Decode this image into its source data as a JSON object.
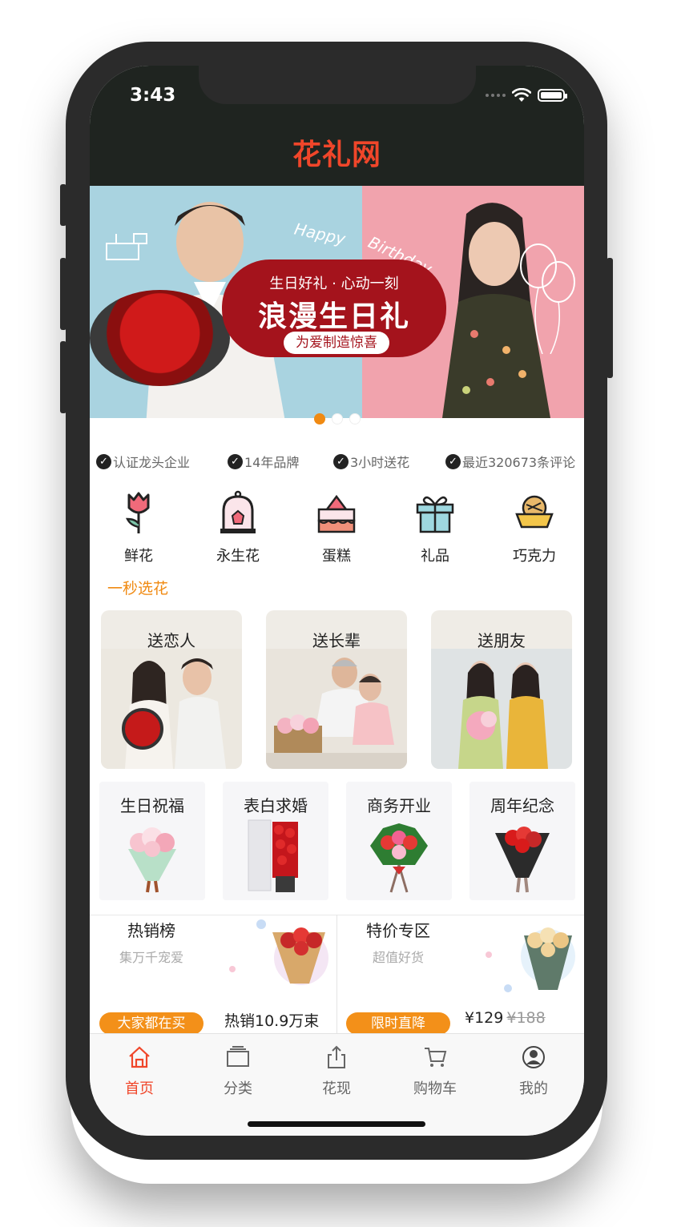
{
  "status": {
    "time": "3:43"
  },
  "app": {
    "title": "花礼网"
  },
  "banner": {
    "subtitle": "生日好礼 · 心动一刻",
    "title": "浪漫生日礼",
    "pill": "为爱制造惊喜",
    "script_left": "Happy",
    "script_right": "Birthday",
    "active_dot": 1,
    "dot_count": 3
  },
  "trust": [
    "认证龙头企业",
    "14年品牌",
    "3小时送花",
    "最近320673条评论"
  ],
  "categories": [
    {
      "label": "鲜花",
      "icon": "tulip-icon"
    },
    {
      "label": "永生花",
      "icon": "glass-dome-flower-icon"
    },
    {
      "label": "蛋糕",
      "icon": "cake-icon"
    },
    {
      "label": "礼品",
      "icon": "gift-box-icon"
    },
    {
      "label": "巧克力",
      "icon": "chocolate-icon"
    }
  ],
  "quick_pick": {
    "label": "一秒选花",
    "occasions": [
      {
        "label": "送恋人"
      },
      {
        "label": "送长辈"
      },
      {
        "label": "送朋友"
      }
    ]
  },
  "purposes": [
    {
      "label": "生日祝福"
    },
    {
      "label": "表白求婚"
    },
    {
      "label": "商务开业"
    },
    {
      "label": "周年纪念"
    }
  ],
  "promos": {
    "hot": {
      "title": "热销榜",
      "subtitle": "集万千宠爱",
      "pill": "大家都在买",
      "caption": "热销10.9万束"
    },
    "deal": {
      "title": "特价专区",
      "subtitle": "超值好货",
      "pill": "限时直降",
      "price_now": "¥129",
      "price_old": "¥188"
    }
  },
  "tabs": [
    {
      "label": "首页",
      "icon": "home-icon",
      "active": true
    },
    {
      "label": "分类",
      "icon": "category-icon",
      "active": false
    },
    {
      "label": "花现",
      "icon": "share-icon",
      "active": false
    },
    {
      "label": "购物车",
      "icon": "cart-icon",
      "active": false
    },
    {
      "label": "我的",
      "icon": "profile-icon",
      "active": false
    }
  ],
  "colors": {
    "accent": "#f0462a",
    "orange": "#f39019",
    "header_bg": "#1f2420",
    "banner_red": "#a4131c"
  }
}
